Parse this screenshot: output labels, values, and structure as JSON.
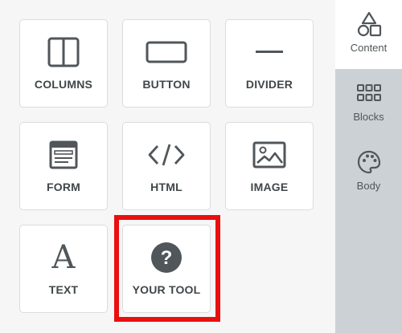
{
  "tools": [
    {
      "label": "COLUMNS",
      "icon": "columns-icon"
    },
    {
      "label": "BUTTON",
      "icon": "button-icon"
    },
    {
      "label": "DIVIDER",
      "icon": "divider-icon"
    },
    {
      "label": "FORM",
      "icon": "form-icon"
    },
    {
      "label": "HTML",
      "icon": "html-icon"
    },
    {
      "label": "IMAGE",
      "icon": "image-icon"
    },
    {
      "label": "TEXT",
      "icon": "text-icon"
    },
    {
      "label": "YOUR TOOL",
      "icon": "question-icon"
    }
  ],
  "sidebar": {
    "tabs": [
      {
        "label": "Content",
        "icon": "shapes-icon",
        "active": true
      },
      {
        "label": "Blocks",
        "icon": "grid-icon",
        "active": false
      },
      {
        "label": "Body",
        "icon": "palette-icon",
        "active": false
      }
    ]
  },
  "colors": {
    "highlight": "#ea0f0f",
    "sidebar_bg": "#ccd1d6",
    "tile_bg": "#ffffff",
    "page_bg": "#f6f6f7",
    "icon": "#505659"
  }
}
